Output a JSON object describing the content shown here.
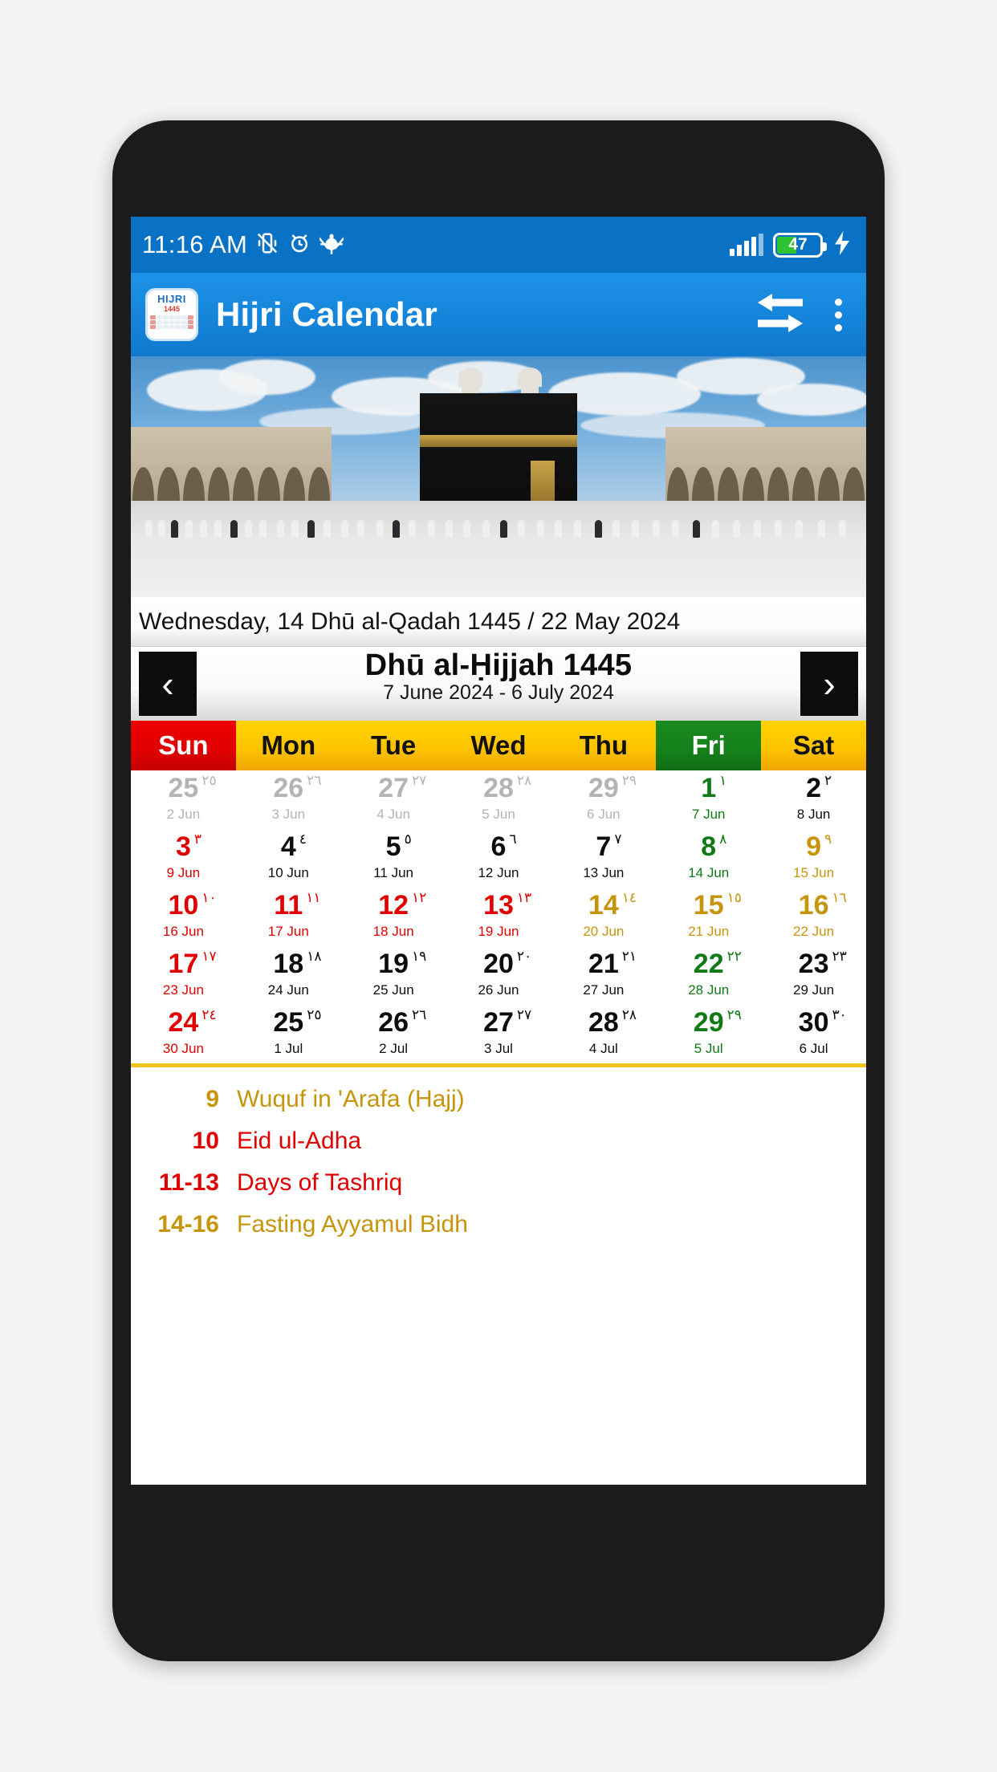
{
  "status_bar": {
    "time": "11:16 AM",
    "icons": [
      "vibrate-off-icon",
      "alarm-icon",
      "bug-icon",
      "signal-icon",
      "battery-icon",
      "charging-bolt-icon"
    ],
    "battery_percent": "47",
    "battery_color": "#2fc32f"
  },
  "app_bar": {
    "title": "Hijri Calendar",
    "icon_top_text": "HIJRI",
    "icon_year_text": "1445",
    "actions": [
      "compare-arrows-icon",
      "overflow-menu-icon"
    ]
  },
  "hero": {
    "alt": "kaaba-photo"
  },
  "today_line": "Wednesday, 14 Dhū al-Qadah 1445 / 22 May 2024",
  "month_header": {
    "prev_label": "‹",
    "next_label": "›",
    "month_name": "Dhū al-Ḥijjah  1445",
    "range": "7 June 2024 - 6 July 2024"
  },
  "weekdays": [
    {
      "label": "Sun",
      "style": "sun"
    },
    {
      "label": "Mon",
      "style": ""
    },
    {
      "label": "Tue",
      "style": ""
    },
    {
      "label": "Wed",
      "style": ""
    },
    {
      "label": "Thu",
      "style": ""
    },
    {
      "label": "Fri",
      "style": "fri"
    },
    {
      "label": "Sat",
      "style": ""
    }
  ],
  "colors": {
    "accent_blue": "#1484da",
    "status_blue": "#0a72c4",
    "sun_red": "#ee0000",
    "fri_green": "#1a8a1f",
    "weekday_yellow": "#ffd400",
    "gold": "#c7950c",
    "divider": "#f0c419"
  },
  "calendar": {
    "cells": [
      {
        "hijri": "25",
        "arabic": "٢٥",
        "greg": "2 Jun",
        "color": "c-gray"
      },
      {
        "hijri": "26",
        "arabic": "٢٦",
        "greg": "3 Jun",
        "color": "c-gray"
      },
      {
        "hijri": "27",
        "arabic": "٢٧",
        "greg": "4 Jun",
        "color": "c-gray"
      },
      {
        "hijri": "28",
        "arabic": "٢٨",
        "greg": "5 Jun",
        "color": "c-gray"
      },
      {
        "hijri": "29",
        "arabic": "٢٩",
        "greg": "6 Jun",
        "color": "c-gray"
      },
      {
        "hijri": "1",
        "arabic": "١",
        "greg": "7 Jun",
        "color": "c-green"
      },
      {
        "hijri": "2",
        "arabic": "٢",
        "greg": "8 Jun",
        "color": "c-black"
      },
      {
        "hijri": "3",
        "arabic": "٣",
        "greg": "9 Jun",
        "color": "c-red"
      },
      {
        "hijri": "4",
        "arabic": "٤",
        "greg": "10 Jun",
        "color": "c-black"
      },
      {
        "hijri": "5",
        "arabic": "٥",
        "greg": "11 Jun",
        "color": "c-black"
      },
      {
        "hijri": "6",
        "arabic": "٦",
        "greg": "12 Jun",
        "color": "c-black"
      },
      {
        "hijri": "7",
        "arabic": "٧",
        "greg": "13 Jun",
        "color": "c-black"
      },
      {
        "hijri": "8",
        "arabic": "٨",
        "greg": "14 Jun",
        "color": "c-green"
      },
      {
        "hijri": "9",
        "arabic": "٩",
        "greg": "15 Jun",
        "color": "c-gold"
      },
      {
        "hijri": "10",
        "arabic": "١٠",
        "greg": "16 Jun",
        "color": "c-red"
      },
      {
        "hijri": "11",
        "arabic": "١١",
        "greg": "17 Jun",
        "color": "c-red"
      },
      {
        "hijri": "12",
        "arabic": "١٢",
        "greg": "18 Jun",
        "color": "c-red"
      },
      {
        "hijri": "13",
        "arabic": "١٣",
        "greg": "19 Jun",
        "color": "c-red"
      },
      {
        "hijri": "14",
        "arabic": "١٤",
        "greg": "20 Jun",
        "color": "c-gold"
      },
      {
        "hijri": "15",
        "arabic": "١٥",
        "greg": "21 Jun",
        "color": "c-gold"
      },
      {
        "hijri": "16",
        "arabic": "١٦",
        "greg": "22 Jun",
        "color": "c-gold"
      },
      {
        "hijri": "17",
        "arabic": "١٧",
        "greg": "23 Jun",
        "color": "c-red"
      },
      {
        "hijri": "18",
        "arabic": "١٨",
        "greg": "24 Jun",
        "color": "c-black"
      },
      {
        "hijri": "19",
        "arabic": "١٩",
        "greg": "25 Jun",
        "color": "c-black"
      },
      {
        "hijri": "20",
        "arabic": "٢٠",
        "greg": "26 Jun",
        "color": "c-black"
      },
      {
        "hijri": "21",
        "arabic": "٢١",
        "greg": "27 Jun",
        "color": "c-black"
      },
      {
        "hijri": "22",
        "arabic": "٢٢",
        "greg": "28 Jun",
        "color": "c-green"
      },
      {
        "hijri": "23",
        "arabic": "٢٣",
        "greg": "29 Jun",
        "color": "c-black"
      },
      {
        "hijri": "24",
        "arabic": "٢٤",
        "greg": "30 Jun",
        "color": "c-red"
      },
      {
        "hijri": "25",
        "arabic": "٢٥",
        "greg": "1 Jul",
        "color": "c-black"
      },
      {
        "hijri": "26",
        "arabic": "٢٦",
        "greg": "2 Jul",
        "color": "c-black"
      },
      {
        "hijri": "27",
        "arabic": "٢٧",
        "greg": "3 Jul",
        "color": "c-black"
      },
      {
        "hijri": "28",
        "arabic": "٢٨",
        "greg": "4 Jul",
        "color": "c-black"
      },
      {
        "hijri": "29",
        "arabic": "٢٩",
        "greg": "5 Jul",
        "color": "c-green"
      },
      {
        "hijri": "30",
        "arabic": "٣٠",
        "greg": "6 Jul",
        "color": "c-black"
      }
    ]
  },
  "events": [
    {
      "day": "9",
      "label": "Wuquf in 'Arafa (Hajj)",
      "color": "e-gold"
    },
    {
      "day": "10",
      "label": "Eid ul-Adha",
      "color": "e-red"
    },
    {
      "day": "11-13",
      "label": "Days of Tashriq",
      "color": "e-red"
    },
    {
      "day": "14-16",
      "label": "Fasting Ayyamul Bidh",
      "color": "e-gold"
    }
  ]
}
